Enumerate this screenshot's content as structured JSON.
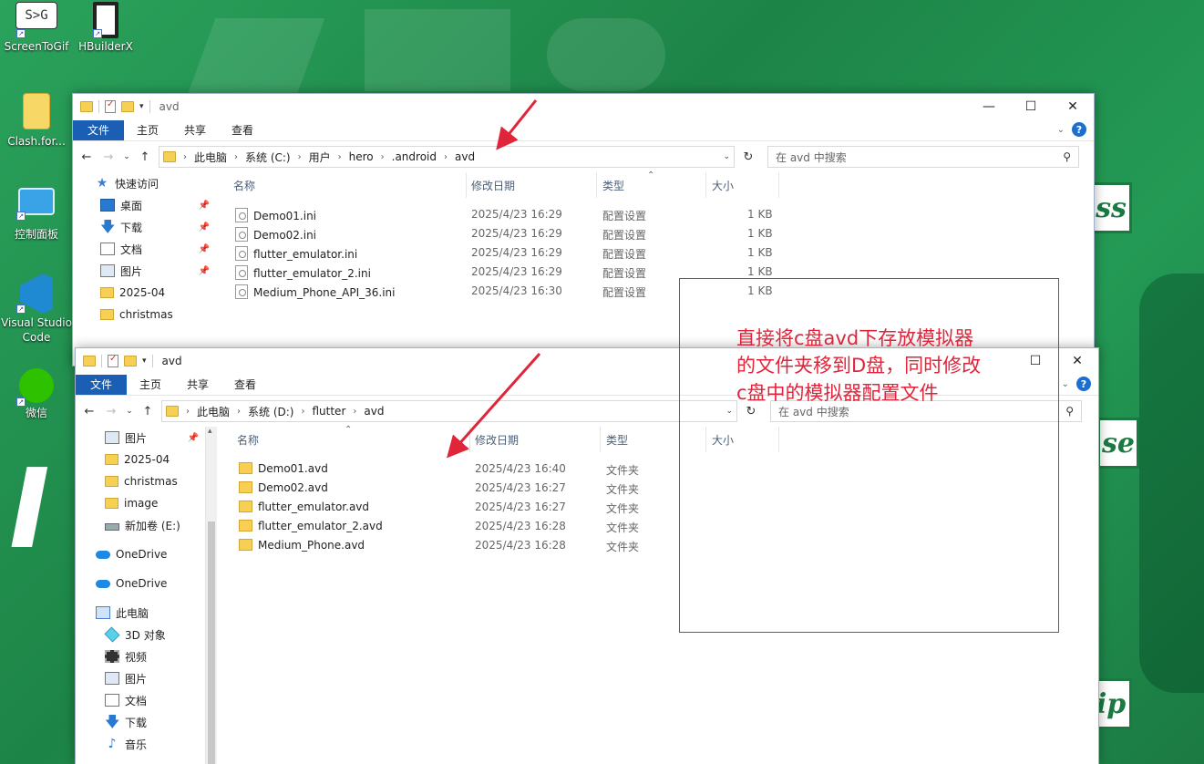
{
  "colors": {
    "accent": "#1a5fb4",
    "annotation": "#e0243a",
    "desktop": "#1f8a4e"
  },
  "desktop": {
    "icons": [
      {
        "label": "ScreenToGif",
        "icon": "screentogif-icon"
      },
      {
        "label": "HBuilderX",
        "icon": "hbuilderx-icon"
      },
      {
        "label": "Clash.for...",
        "icon": "folder-icon"
      },
      {
        "label": "控制面板",
        "icon": "control-panel-icon"
      },
      {
        "label": "Visual Studio Code",
        "icon": "vscode-icon"
      },
      {
        "label": "微信",
        "icon": "wechat-icon"
      }
    ],
    "screentogif_glyph": "S>G",
    "wallpaper_badges": [
      "ss",
      "se",
      "ip"
    ]
  },
  "window1": {
    "title": "avd",
    "ribbon": {
      "file": "文件",
      "home": "主页",
      "share": "共享",
      "view": "查看"
    },
    "address": [
      "此电脑",
      "系统 (C:)",
      "用户",
      "hero",
      ".android",
      "avd"
    ],
    "search_placeholder": "在 avd 中搜索",
    "nav": {
      "quick_access": "快速访问",
      "items": [
        "桌面",
        "下载",
        "文档",
        "图片",
        "2025-04",
        "christmas"
      ]
    },
    "columns": {
      "name": "名称",
      "date": "修改日期",
      "type": "类型",
      "size": "大小"
    },
    "files": [
      {
        "name": "Demo01.ini",
        "date": "2025/4/23 16:29",
        "type": "配置设置",
        "size": "1 KB"
      },
      {
        "name": "Demo02.ini",
        "date": "2025/4/23 16:29",
        "type": "配置设置",
        "size": "1 KB"
      },
      {
        "name": "flutter_emulator.ini",
        "date": "2025/4/23 16:29",
        "type": "配置设置",
        "size": "1 KB"
      },
      {
        "name": "flutter_emulator_2.ini",
        "date": "2025/4/23 16:29",
        "type": "配置设置",
        "size": "1 KB"
      },
      {
        "name": "Medium_Phone_API_36.ini",
        "date": "2025/4/23 16:30",
        "type": "配置设置",
        "size": "1 KB"
      }
    ]
  },
  "window2": {
    "title": "avd",
    "ribbon": {
      "file": "文件",
      "home": "主页",
      "share": "共享",
      "view": "查看"
    },
    "address": [
      "此电脑",
      "系统 (D:)",
      "flutter",
      "avd"
    ],
    "search_placeholder": "在 avd 中搜索",
    "nav": {
      "items": [
        "图片",
        "2025-04",
        "christmas",
        "image",
        "新加卷 (E:)",
        "OneDrive",
        "OneDrive",
        "此电脑",
        "3D 对象",
        "视频",
        "图片",
        "文档",
        "下载",
        "音乐"
      ]
    },
    "columns": {
      "name": "名称",
      "date": "修改日期",
      "type": "类型",
      "size": "大小"
    },
    "files": [
      {
        "name": "Demo01.avd",
        "date": "2025/4/23 16:40",
        "type": "文件夹"
      },
      {
        "name": "Demo02.avd",
        "date": "2025/4/23 16:27",
        "type": "文件夹"
      },
      {
        "name": "flutter_emulator.avd",
        "date": "2025/4/23 16:27",
        "type": "文件夹"
      },
      {
        "name": "flutter_emulator_2.avd",
        "date": "2025/4/23 16:28",
        "type": "文件夹"
      },
      {
        "name": "Medium_Phone.avd",
        "date": "2025/4/23 16:28",
        "type": "文件夹"
      }
    ]
  },
  "annotation": {
    "lines": [
      "直接将c盘avd下存放模拟器",
      "的文件夹移到D盘，同时修改",
      "c盘中的模拟器配置文件"
    ]
  }
}
